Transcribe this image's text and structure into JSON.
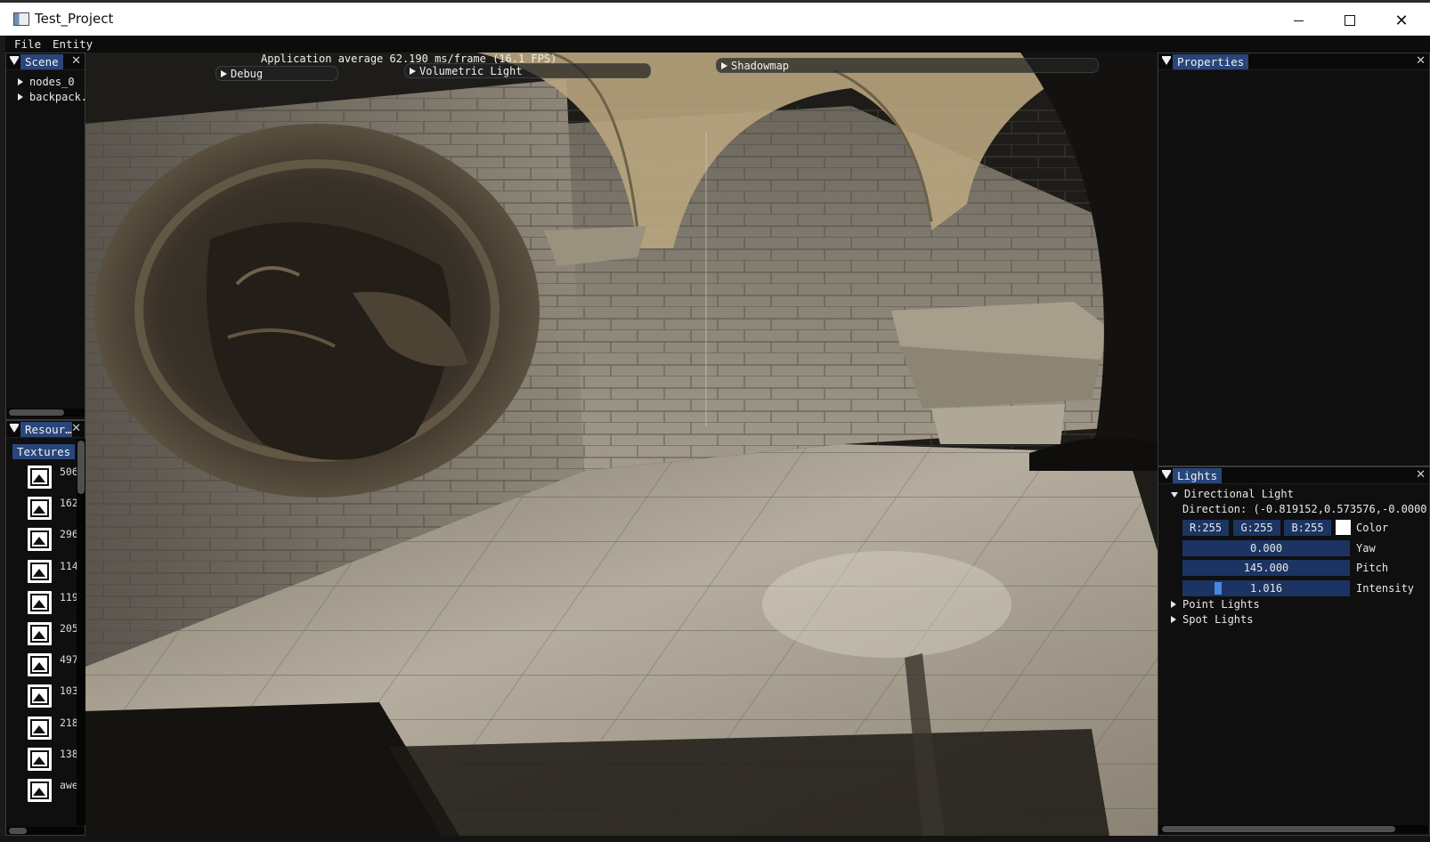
{
  "window": {
    "title": "Test_Project"
  },
  "menu": {
    "file": "File",
    "entity": "Entity"
  },
  "scene_panel": {
    "tab": "Scene",
    "items": [
      "nodes_0",
      "backpack."
    ]
  },
  "resources_panel": {
    "tab": "Resour…",
    "subtab": "Textures",
    "textures": [
      "506",
      "162",
      "296",
      "114",
      "119",
      "205",
      "497",
      "103",
      "218",
      "138",
      "awe"
    ]
  },
  "overlay": {
    "fps_text": "Application average 62.190 ms/frame (16.1 FPS)",
    "debug": "Debug",
    "volumetric": "Volumetric Light",
    "shadowmap": "Shadowmap"
  },
  "properties_panel": {
    "tab": "Properties"
  },
  "lights_panel": {
    "tab": "Lights",
    "directional": {
      "header": "Directional Light",
      "direction": "Direction: (-0.819152,0.573576,-0.0000",
      "r": "R:255",
      "g": "G:255",
      "b": "B:255",
      "color_label": "Color",
      "yaw_value": "0.000",
      "yaw_label": "Yaw",
      "pitch_value": "145.000",
      "pitch_label": "Pitch",
      "intensity_value": "1.016",
      "intensity_label": "Intensity",
      "intensity_fraction": 0.2,
      "color_hex": "#ffffff"
    },
    "point_lights": "Point Lights",
    "spot_lights": "Spot Lights"
  },
  "colors": {
    "accent": "#29467a",
    "field": "#1b3461",
    "grab": "#4a88e0"
  },
  "icons": {
    "title_icon": "app-window-icon",
    "texture_icon": "image-icon"
  }
}
